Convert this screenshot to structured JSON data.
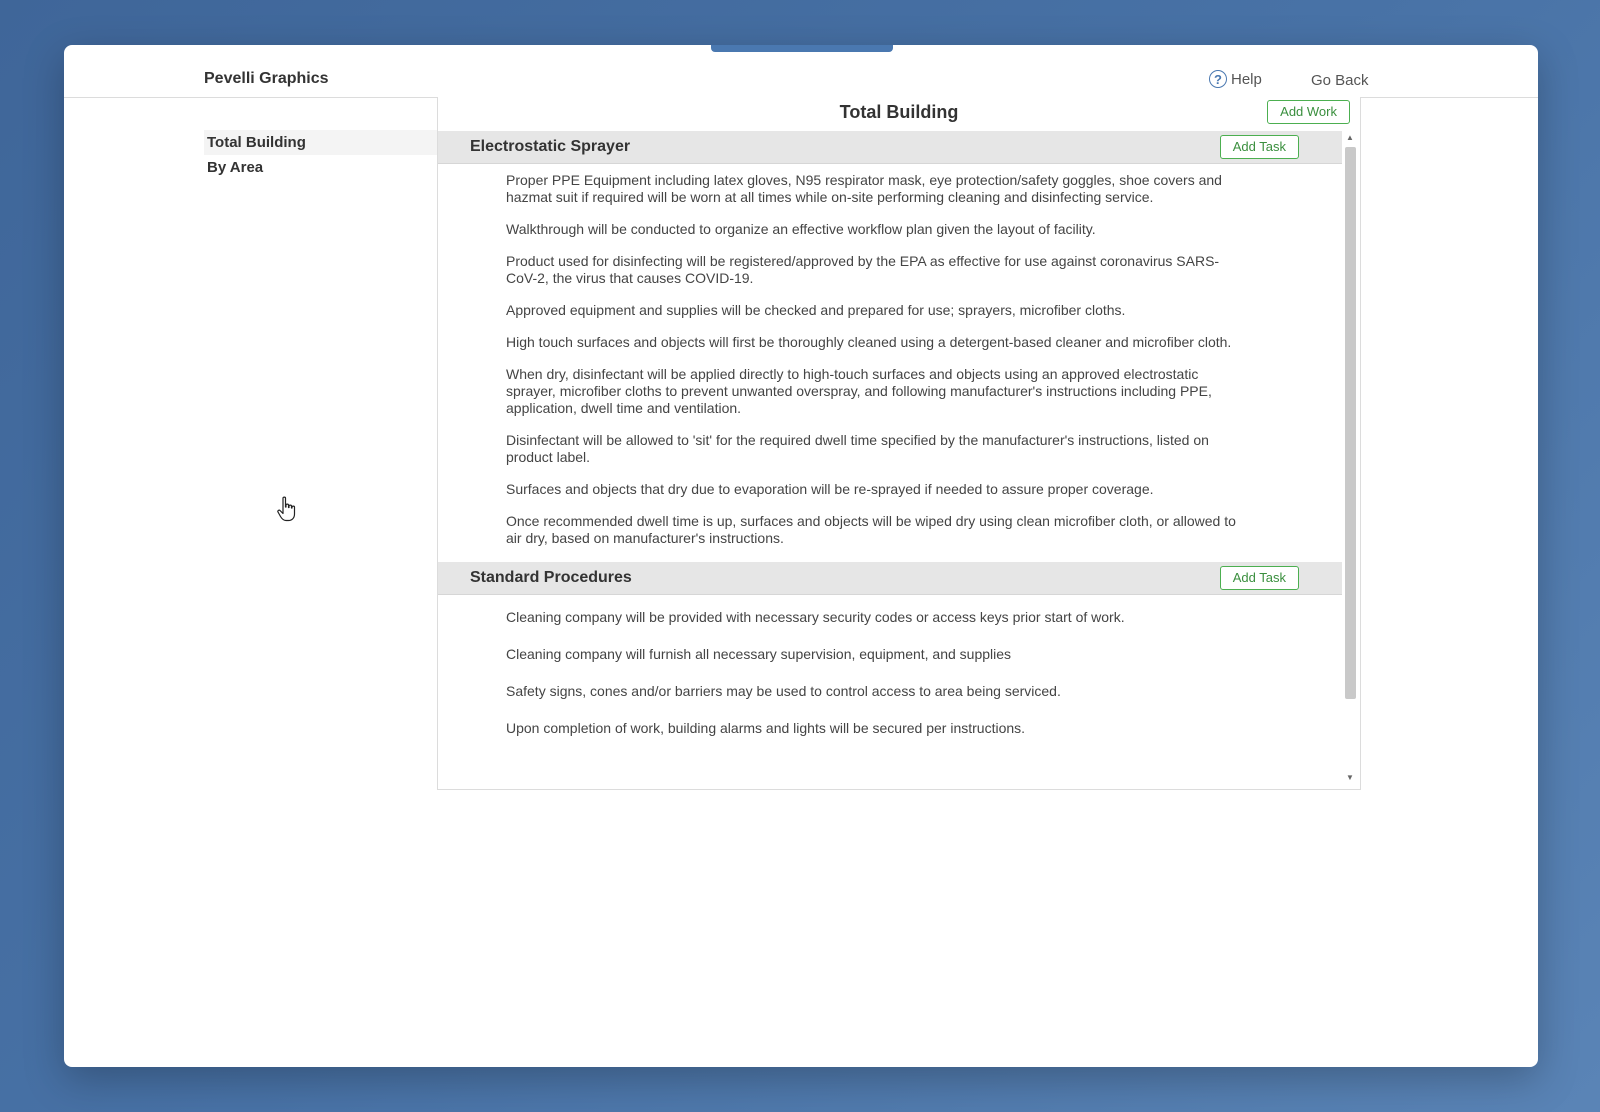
{
  "header": {
    "brand": "Pevelli Graphics",
    "help_label": "Help",
    "go_back_label": "Go Back"
  },
  "sidebar": {
    "items": [
      {
        "label": "Total Building",
        "active": true
      },
      {
        "label": "By Area",
        "active": false
      }
    ]
  },
  "panel": {
    "title": "Total Building",
    "add_work_label": "Add Work",
    "sections": [
      {
        "title": "Electrostatic Sprayer",
        "add_task_label": "Add Task",
        "tasks": [
          "Proper PPE Equipment including latex gloves, N95 respirator mask, eye protection/safety goggles, shoe covers and hazmat suit if required will be worn at all times while on-site performing cleaning and disinfecting service.",
          "Walkthrough will be conducted to organize an effective workflow plan given the layout of facility.",
          "Product used for disinfecting will be registered/approved by the EPA as effective for use against coronavirus SARS-CoV-2, the virus that causes COVID-19.",
          "Approved equipment and supplies will be checked and prepared for use; sprayers, microfiber cloths.",
          "High touch surfaces and objects will first be thoroughly cleaned using a detergent-based cleaner and microfiber cloth.",
          "When dry, disinfectant will be applied directly to high-touch surfaces and objects using an approved electrostatic sprayer, microfiber cloths to prevent unwanted overspray, and following manufacturer's instructions including PPE, application, dwell time and ventilation.",
          "Disinfectant will be allowed to 'sit' for the required dwell time specified by the manufacturer's instructions, listed on product label.",
          "Surfaces and objects that dry due to evaporation will be re-sprayed if needed to assure proper coverage.",
          "Once recommended dwell time is up, surfaces and objects will be wiped dry using clean microfiber cloth, or allowed to air dry, based on manufacturer's instructions."
        ]
      },
      {
        "title": "Standard Procedures",
        "add_task_label": "Add Task",
        "tasks": [
          "Cleaning company will be provided with necessary security codes or access keys prior start of work.",
          "Cleaning company will furnish all necessary supervision, equipment, and supplies",
          "Safety signs, cones and/or barriers may be used to control access to area being serviced.",
          "Upon completion of work, building alarms and lights will be secured per instructions."
        ]
      }
    ]
  },
  "icons": {
    "help": "question-circle-icon",
    "scroll_up": "caret-up-icon",
    "scroll_down": "caret-down-icon",
    "cursor": "hand-pointer-icon"
  },
  "colors": {
    "background": "#4872a6",
    "accent": "#4a78b0",
    "button_border": "#4caf50",
    "section_header": "#e6e6e6"
  }
}
